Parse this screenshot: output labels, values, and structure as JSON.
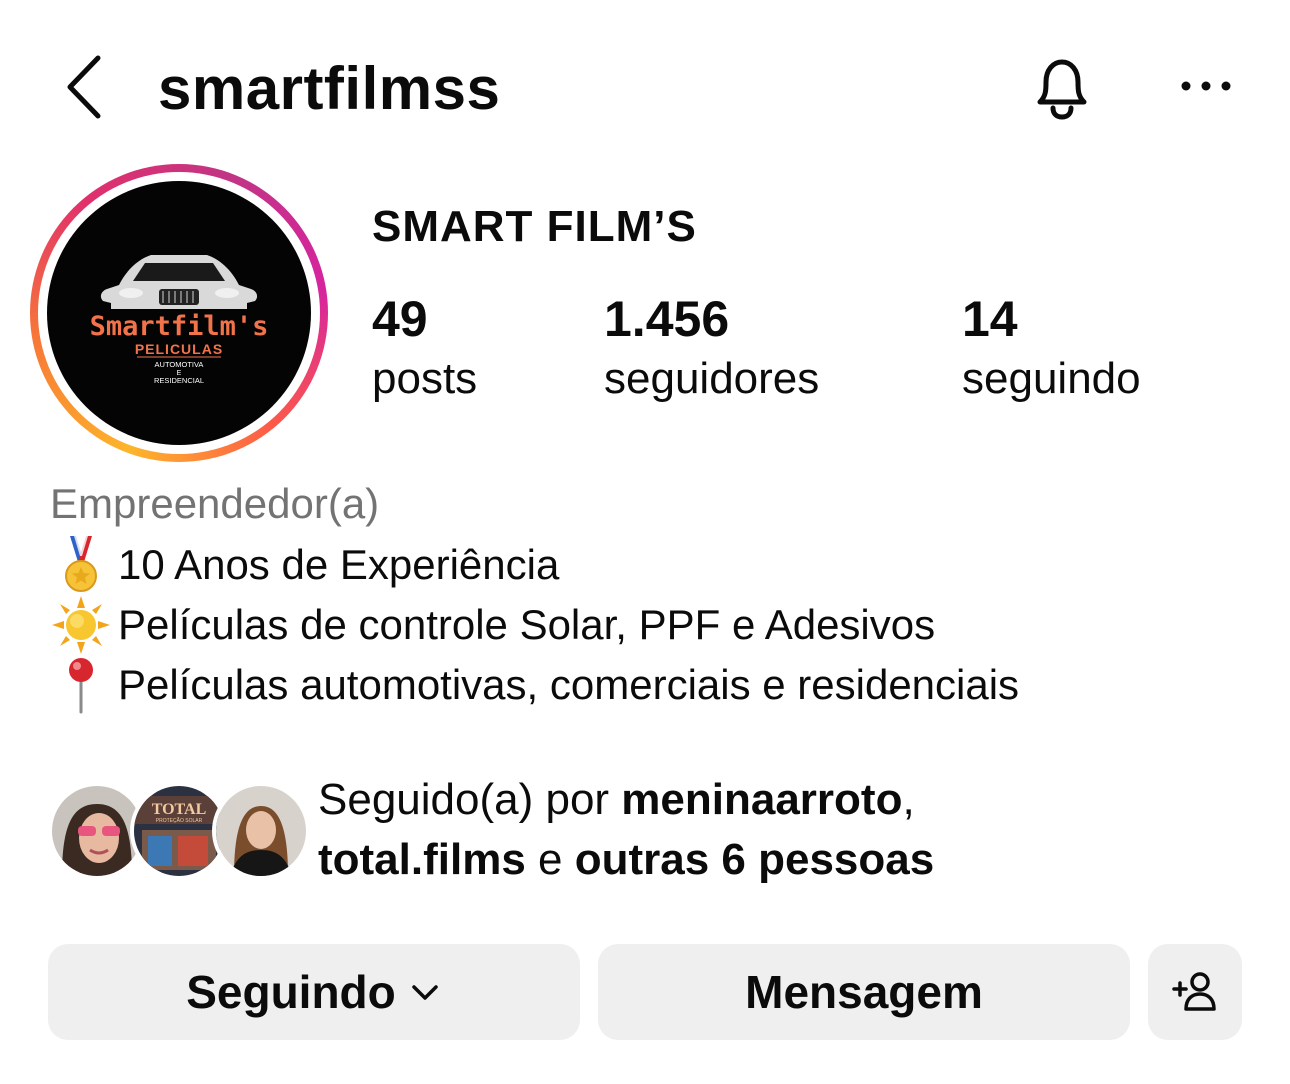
{
  "header": {
    "username": "smartfilmss",
    "back_icon": "chevron-left-icon",
    "bell_icon": "bell-icon",
    "more_icon": "ellipsis-icon"
  },
  "profile": {
    "display_name": "SMART FILM’S",
    "avatar_logo": {
      "brand": "Smartfilm's",
      "line1": "PELICULAS",
      "line2": "AUTOMOTIVA",
      "line3": "E",
      "line4": "RESIDENCIAL"
    }
  },
  "stats": {
    "posts_count": "49",
    "posts_label": "posts",
    "followers_count": "1.456",
    "followers_label": "seguidores",
    "following_count": "14",
    "following_label": "seguindo"
  },
  "bio": {
    "category": "Empreendedor(a)",
    "lines": [
      {
        "icon": "medal-icon",
        "text": "10 Anos de Experiência"
      },
      {
        "icon": "sun-icon",
        "text": "Películas de controle Solar, PPF e Adesivos"
      },
      {
        "icon": "pushpin-icon",
        "text": "Películas automotivas, comerciais e residenciais"
      }
    ]
  },
  "mutuals": {
    "prefix": "Seguido(a) por ",
    "user1": "meninaarroto",
    "comma": ",",
    "user2": "total.films",
    "joiner": " e ",
    "others": "outras 6 pessoas",
    "avatar2_text": "TOTAL",
    "avatar2_sub": "PROTEÇÃO SOLAR"
  },
  "actions": {
    "following_label": "Seguindo",
    "message_label": "Mensagem",
    "following_icon": "chevron-down-icon",
    "add_person_icon": "person-add-icon"
  },
  "colors": {
    "ring_start": "#fdb52a",
    "ring_mid": "#e1306c",
    "ring_end": "#c13584",
    "button_bg": "#efefef",
    "secondary_text": "#737373"
  }
}
